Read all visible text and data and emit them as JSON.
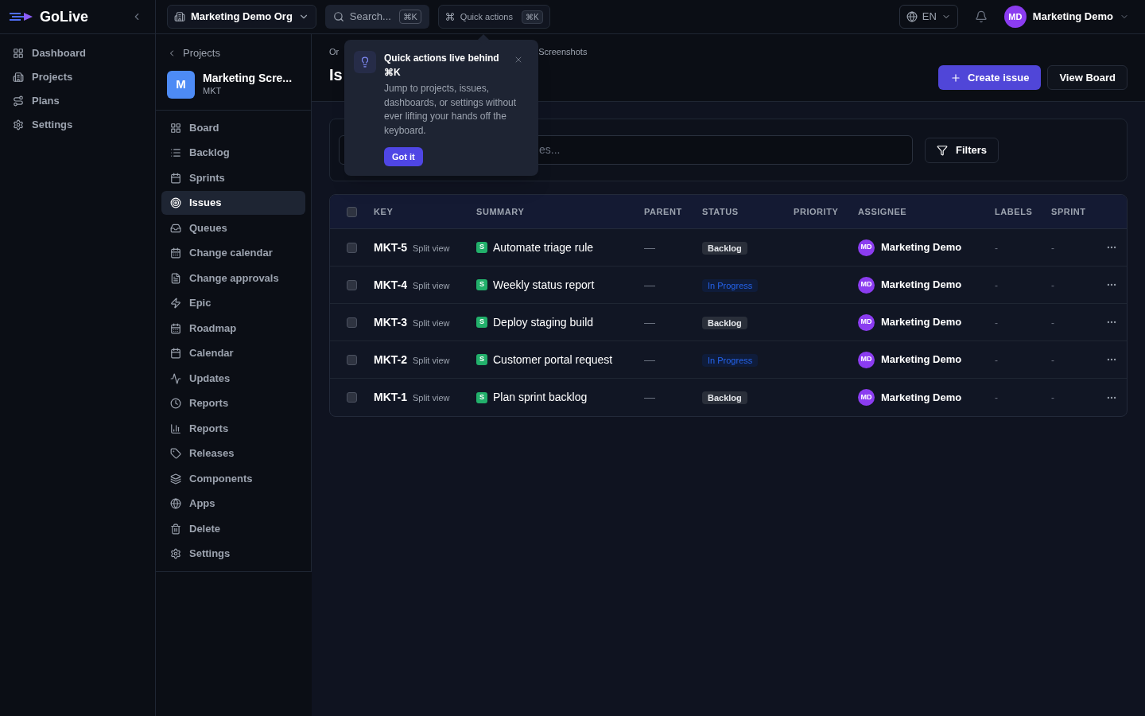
{
  "app": {
    "name": "GoLive"
  },
  "main_nav": [
    {
      "label": "Dashboard",
      "selected": false
    },
    {
      "label": "Projects",
      "selected": false
    },
    {
      "label": "Plans",
      "selected": false
    },
    {
      "label": "Settings",
      "selected": false
    }
  ],
  "topbar": {
    "org": "Marketing Demo Org",
    "search": {
      "placeholder": "Search...",
      "shortcut": "⌘K"
    },
    "quick_actions": {
      "label": "Quick actions",
      "shortcut": "⌘K"
    },
    "language": "EN",
    "user": {
      "initials": "MD",
      "name": "Marketing Demo"
    }
  },
  "project": {
    "back": "Projects",
    "avatar": "M",
    "name": "Marketing Scre...",
    "key": "MKT"
  },
  "project_nav": [
    {
      "label": "Board",
      "selected": false
    },
    {
      "label": "Backlog",
      "selected": false
    },
    {
      "label": "Sprints",
      "selected": false
    },
    {
      "label": "Issues",
      "selected": true
    },
    {
      "label": "Queues",
      "selected": false
    },
    {
      "label": "Change calendar",
      "selected": false
    },
    {
      "label": "Change approvals",
      "selected": false
    },
    {
      "label": "Epic",
      "selected": false
    },
    {
      "label": "Roadmap",
      "selected": false
    },
    {
      "label": "Calendar",
      "selected": false
    },
    {
      "label": "Updates",
      "selected": false
    },
    {
      "label": "Reports",
      "selected": false
    },
    {
      "label": "Reports",
      "selected": false
    },
    {
      "label": "Releases",
      "selected": false
    },
    {
      "label": "Components",
      "selected": false
    },
    {
      "label": "Apps",
      "selected": false
    },
    {
      "label": "Delete",
      "selected": false
    },
    {
      "label": "Settings",
      "selected": false
    }
  ],
  "page": {
    "breadcrumb": [
      "Or",
      "Screenshots"
    ],
    "title": "Is",
    "actions": [
      "Create issue",
      "View Board"
    ]
  },
  "filter_bar": {
    "search_visible_text": "es...",
    "filters": "Filters"
  },
  "popover": {
    "title": "Quick actions live behind ⌘K",
    "body": "Jump to projects, issues, dashboards, or settings without ever lifting your hands off the keyboard.",
    "button": "Got it"
  },
  "table": {
    "header_checked": false,
    "columns": [
      "KEY",
      "SUMMARY",
      "PARENT",
      "STATUS",
      "PRIORITY",
      "ASSIGNEE",
      "LABELS",
      "SPRINT"
    ],
    "rows": [
      {
        "checked": false,
        "key": "MKT-5",
        "split": "Split view",
        "type": "S",
        "summary": "Automate triage rule",
        "parent": "—",
        "status": {
          "label": "Backlog",
          "kind": "backlog"
        },
        "assignee": {
          "initials": "MD",
          "name": "Marketing Demo"
        },
        "labels": "-",
        "sprint": "-"
      },
      {
        "checked": false,
        "key": "MKT-4",
        "split": "Split view",
        "type": "S",
        "summary": "Weekly status report",
        "parent": "—",
        "status": {
          "label": "In Progress",
          "kind": "in_progress"
        },
        "assignee": {
          "initials": "MD",
          "name": "Marketing Demo"
        },
        "labels": "-",
        "sprint": "-"
      },
      {
        "checked": false,
        "key": "MKT-3",
        "split": "Split view",
        "type": "S",
        "summary": "Deploy staging build",
        "parent": "—",
        "status": {
          "label": "Backlog",
          "kind": "backlog"
        },
        "assignee": {
          "initials": "MD",
          "name": "Marketing Demo"
        },
        "labels": "-",
        "sprint": "-"
      },
      {
        "checked": false,
        "key": "MKT-2",
        "split": "Split view",
        "type": "S",
        "summary": "Customer portal request",
        "parent": "—",
        "status": {
          "label": "In Progress",
          "kind": "in_progress"
        },
        "assignee": {
          "initials": "MD",
          "name": "Marketing Demo"
        },
        "labels": "-",
        "sprint": "-"
      },
      {
        "checked": false,
        "key": "MKT-1",
        "split": "Split view",
        "type": "S",
        "summary": "Plan sprint backlog",
        "parent": "—",
        "status": {
          "label": "Backlog",
          "kind": "backlog"
        },
        "assignee": {
          "initials": "MD",
          "name": "Marketing Demo"
        },
        "labels": "-",
        "sprint": "-"
      }
    ]
  }
}
